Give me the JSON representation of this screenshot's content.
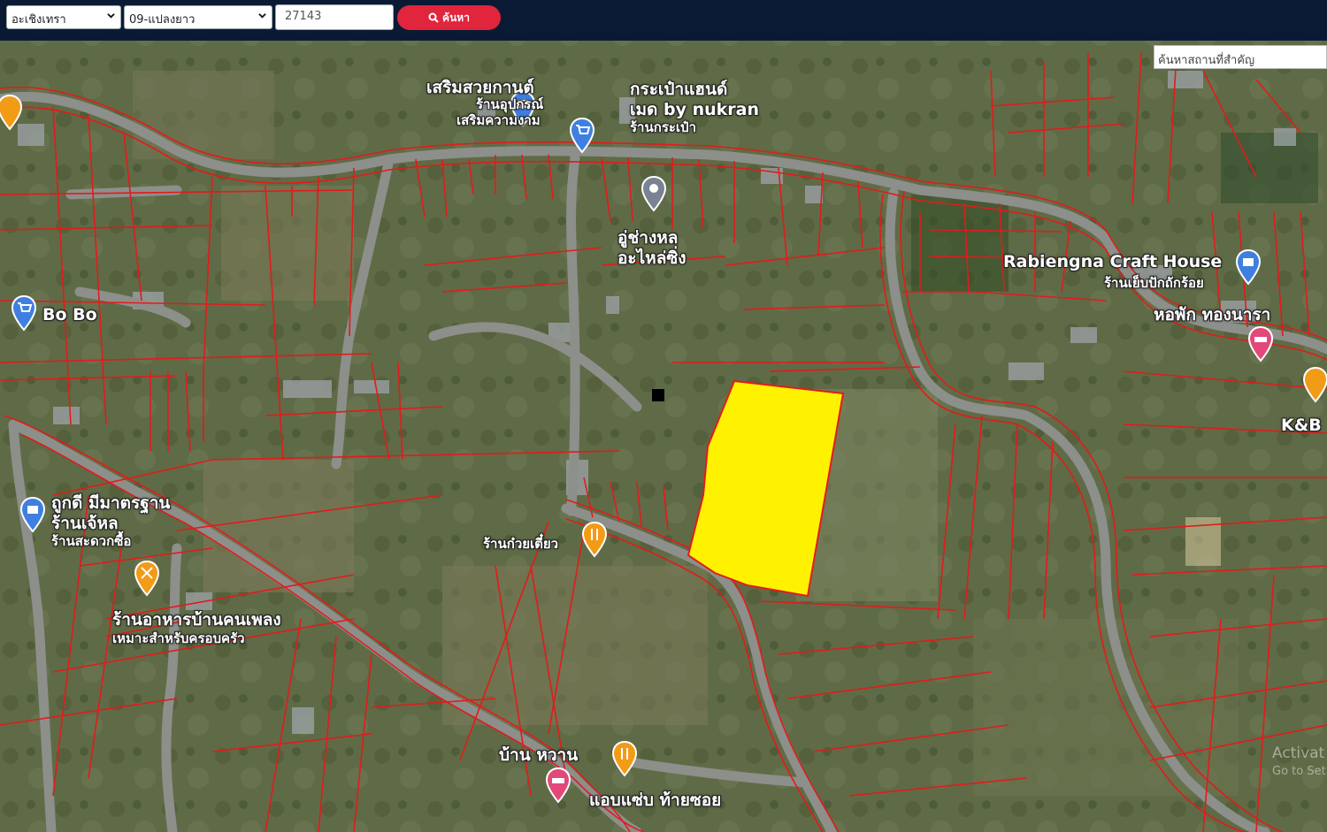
{
  "toolbar": {
    "district_select": "อะเชิงเทรา",
    "layer_select": "09-แปลงยาว",
    "parcel_input": "27143",
    "search_label": "ค้นหา"
  },
  "map": {
    "place_search_placeholder": "ค้นหาสถานที่สำคัญ",
    "labels": {
      "top_left_1": "เสริมสวยกานต์",
      "top_left_2": "ร้านอุปกรณ์",
      "top_left_3": "เสริมความงาม",
      "top_mid_1": "กระเป๋าแฮนด์",
      "top_mid_2": "เมด by nukran",
      "top_mid_3": "ร้านกระเป๋า",
      "garage_1": "อู่ช่างหล",
      "garage_2": "อะไหล่ซิ่ง",
      "craft_house": "Rabiengna Craft House",
      "craft_sub": "ร้านเย็บปักถักร้อย",
      "dorm": "หอพัก ทองนารา",
      "kb": "K&B",
      "bobo": "Bo Bo",
      "laundry_1": "ถูกดี มีมาตรฐาน",
      "laundry_2": "ร้านเจ้หล",
      "laundry_3": "ร้านสะดวกซื้อ",
      "noodle": "ร้านก๋วยเตี๋ยว",
      "restaurant_1": "ร้านอาหารบ้านคนเพลง",
      "restaurant_2": "เหมาะสำหรับครอบครัว",
      "banwan": "บ้าน หวาน",
      "saeb": "แอบแซ่บ ท้ายซอย"
    },
    "watermark": "Activat",
    "watermark_sub": "Go to Set"
  },
  "colors": {
    "topbar": "#0b1a34",
    "search_button": "#e0253d",
    "parcel_line": "#e21b1b",
    "highlight_parcel": "#fff200",
    "road": "#8d8f8b"
  }
}
